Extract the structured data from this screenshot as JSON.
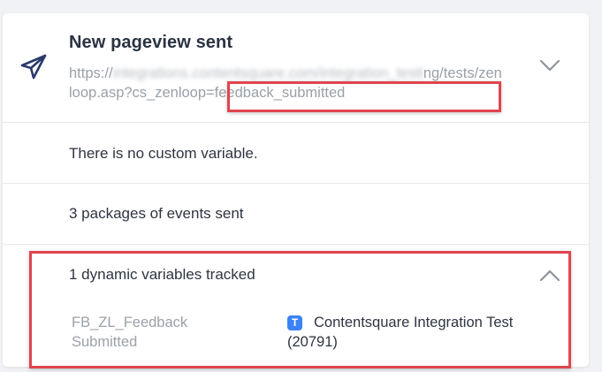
{
  "header": {
    "title": "New pageview sent",
    "url_prefix": "https://",
    "url_blurred": "integrations.contentsquare.com/integration_testi",
    "url_suffix": "ng/tests/zenloop.asp?cs_zenloop=feedback_submitted",
    "icon": "paper-plane-icon"
  },
  "custom_variables": {
    "text": "There is no custom variable."
  },
  "packages": {
    "text": "3 packages of events sent"
  },
  "dynamic_variables": {
    "title": "1 dynamic variables tracked",
    "items": [
      {
        "name": "FB_ZL_Feedback Submitted",
        "badge": "T",
        "value": "Contentsquare Integration Test (20791)"
      }
    ]
  },
  "colors": {
    "highlight": "#e0454e",
    "badge": "#3b82f6",
    "icon": "#2a3a6b"
  }
}
